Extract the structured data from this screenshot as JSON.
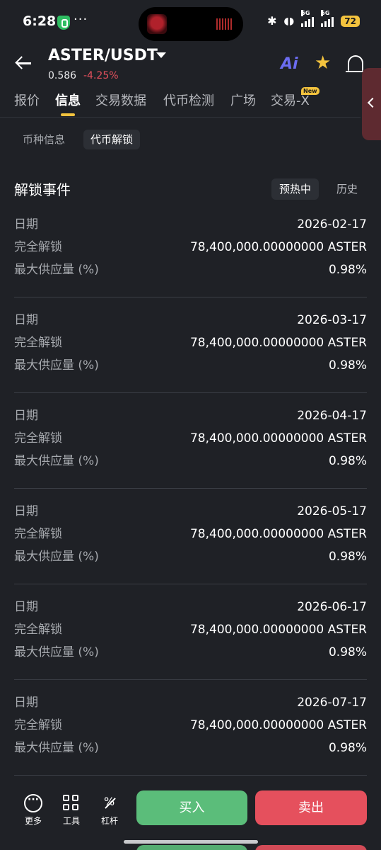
{
  "status_bar": {
    "time": "6:28",
    "more": "···",
    "signal_1": "5G",
    "signal_2": "5G",
    "battery": "72"
  },
  "header": {
    "pair": "ASTER/USDT",
    "price": "0.586",
    "change": "-4.25%",
    "ai_label": "Ai"
  },
  "tabs": [
    {
      "label": "报价"
    },
    {
      "label": "信息"
    },
    {
      "label": "交易数据"
    },
    {
      "label": "代币检测"
    },
    {
      "label": "广场"
    },
    {
      "label": "交易-X"
    }
  ],
  "new_badge": "New",
  "subtabs": [
    {
      "label": "币种信息"
    },
    {
      "label": "代币解锁"
    }
  ],
  "section": {
    "title": "解锁事件",
    "filters": [
      {
        "label": "预热中"
      },
      {
        "label": "历史"
      }
    ]
  },
  "event_labels": {
    "date": "日期",
    "unlock": "完全解锁",
    "supply": "最大供应量 (%)"
  },
  "events": [
    {
      "date": "2026-02-17",
      "unlock": "78,400,000.00000000 ASTER",
      "supply": "0.98%"
    },
    {
      "date": "2026-03-17",
      "unlock": "78,400,000.00000000 ASTER",
      "supply": "0.98%"
    },
    {
      "date": "2026-04-17",
      "unlock": "78,400,000.00000000 ASTER",
      "supply": "0.98%"
    },
    {
      "date": "2026-05-17",
      "unlock": "78,400,000.00000000 ASTER",
      "supply": "0.98%"
    },
    {
      "date": "2026-06-17",
      "unlock": "78,400,000.00000000 ASTER",
      "supply": "0.98%"
    },
    {
      "date": "2026-07-17",
      "unlock": "78,400,000.00000000 ASTER",
      "supply": "0.98%"
    }
  ],
  "bottom": {
    "more": "更多",
    "tools": "工具",
    "leverage": "杠杆",
    "buy": "买入",
    "sell": "卖出"
  },
  "colors": {
    "background": "#1f2126",
    "accent": "#f3c33e",
    "buy": "#5bbd7a",
    "sell": "#e5505d"
  }
}
